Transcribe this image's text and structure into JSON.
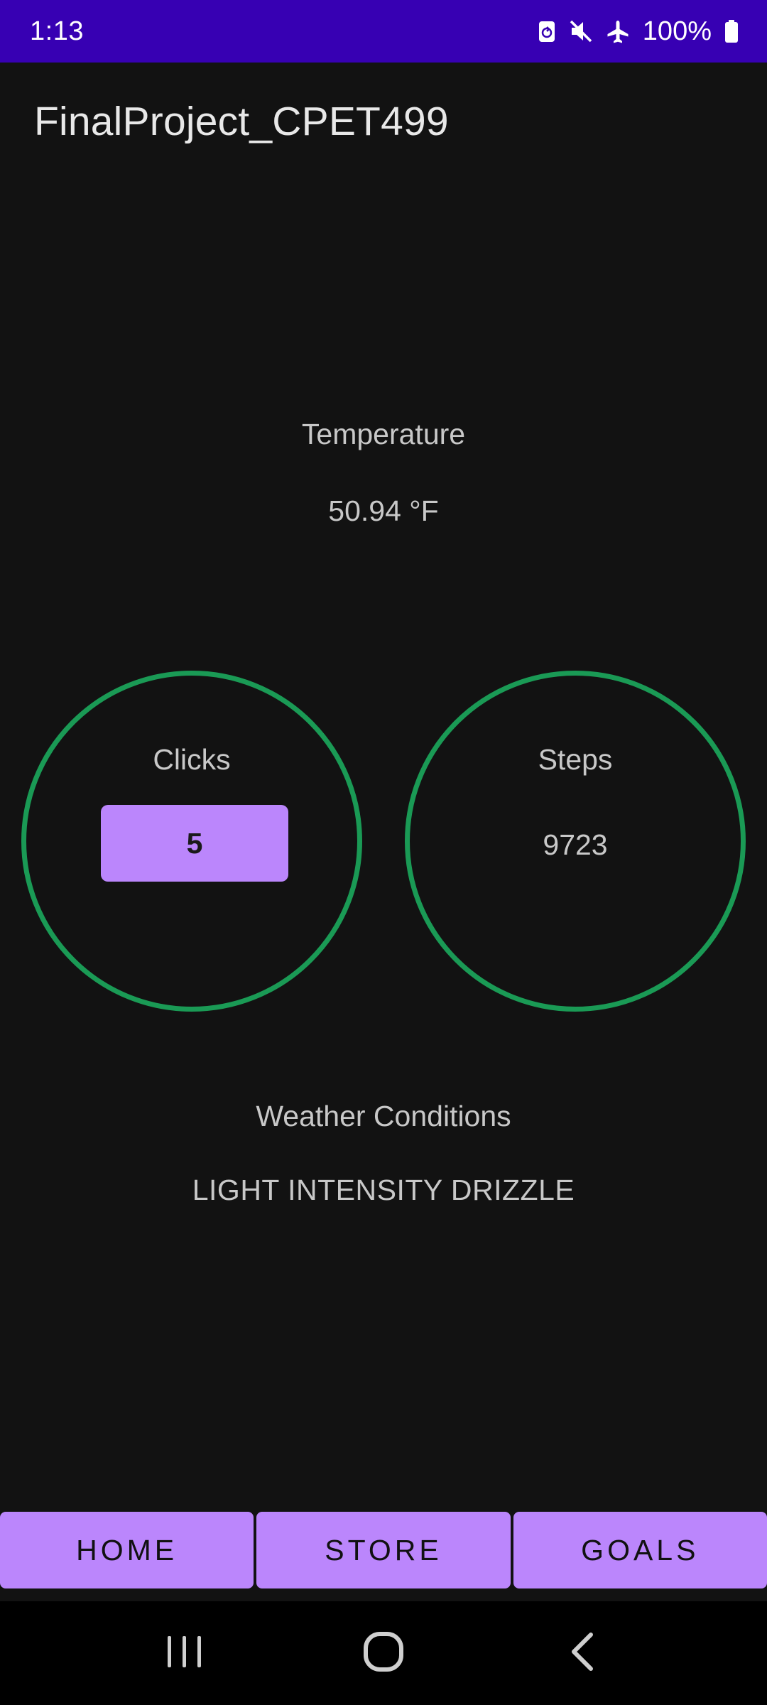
{
  "status_bar": {
    "time": "1:13",
    "battery_percent": "100%",
    "icons": [
      "recycle-icon",
      "mute-icon",
      "airplane-icon",
      "battery-icon"
    ]
  },
  "app": {
    "title": "FinalProject_CPET499"
  },
  "temperature": {
    "label": "Temperature",
    "value": "50.94 °F"
  },
  "clicks": {
    "label": "Clicks",
    "value": "5"
  },
  "steps": {
    "label": "Steps",
    "value": "9723"
  },
  "weather": {
    "label": "Weather Conditions",
    "value": "LIGHT INTENSITY DRIZZLE"
  },
  "bottom_nav": {
    "home": "HOME",
    "store": "STORE",
    "goals": "GOALS"
  },
  "colors": {
    "status_bar": "#3700b3",
    "background": "#121212",
    "accent_purple": "#bb86fc",
    "ring_green": "#1a9a55"
  },
  "system_nav": {
    "icons": [
      "recent-apps-icon",
      "home-icon",
      "back-icon"
    ]
  }
}
